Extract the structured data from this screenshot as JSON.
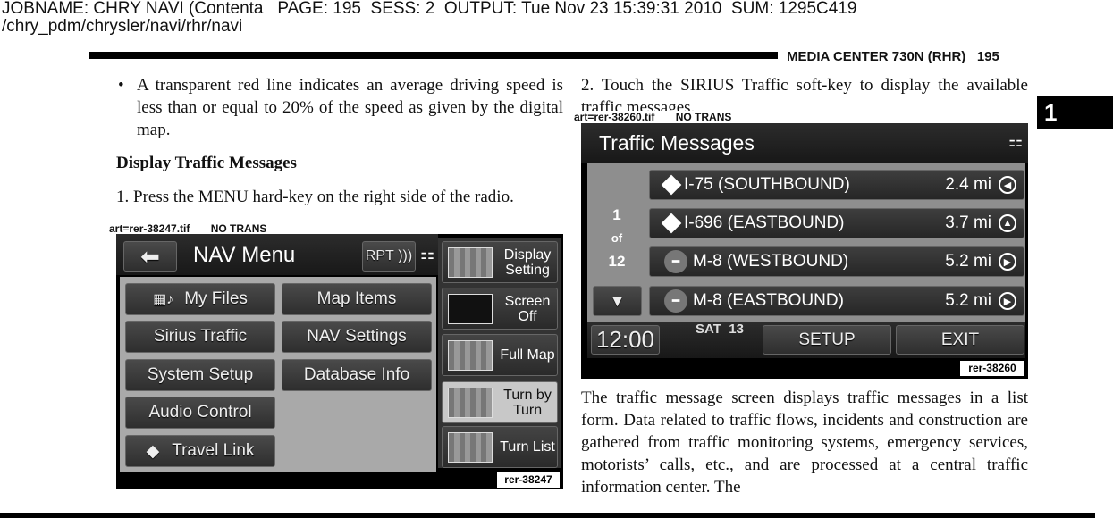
{
  "job_header": {
    "line1": "JOBNAME: CHRY NAVI (Contenta   PAGE: 195  SESS: 2  OUTPUT: Tue Nov 23 15:39:31 2010  SUM: 1295C419",
    "line2": "/chry_pdm/chrysler/navi/rhr/navi"
  },
  "running_head": {
    "title": "MEDIA CENTER 730N (RHR)",
    "page": "195"
  },
  "chapter_tab": "1",
  "left": {
    "bullet": "A transparent red line indicates an average driving speed is less than or equal to 20% of the speed as given by the digital map.",
    "heading": "Display Traffic Messages",
    "step1": "1. Press the MENU hard-key on the right side of the radio.",
    "caption": "art=rer-38247.tif       NO TRANS"
  },
  "nav_menu": {
    "title": "NAV Menu",
    "rpt": "RPT",
    "buttons": [
      "My Files",
      "Map Items",
      "Sirius Traffic",
      "NAV Settings",
      "System Setup",
      "Database Info",
      "Audio Control",
      "Travel Link"
    ],
    "side": [
      "Display Setting",
      "Screen Off",
      "Full Map",
      "Turn by Turn",
      "Turn List"
    ],
    "selected_side": "Turn by Turn",
    "label": "rer-38247"
  },
  "right": {
    "step2": "2. Touch the SIRIUS Traffic soft-key to display the available traffic messages.",
    "caption": "art=rer-38260.tif       NO TRANS",
    "para": "The traffic message screen displays traffic messages in a list form. Data related to traffic flows, incidents and construction are gathered from traffic monitoring systems, emergency services, motorists’ calls, etc., and are processed at a central traffic information center. The"
  },
  "traffic": {
    "title": "Traffic Messages",
    "page_current": "1",
    "page_of": "of",
    "page_total": "12",
    "messages": [
      {
        "road": "I-75 (SOUTHBOUND)",
        "dist": "2.4 mi",
        "icon": "construction-icon"
      },
      {
        "road": "I-696 (EASTBOUND)",
        "dist": "3.7 mi",
        "icon": "info-icon"
      },
      {
        "road": "M-8 (WESTBOUND)",
        "dist": "5.2 mi",
        "icon": "no-entry-icon"
      },
      {
        "road": "M-8 (EASTBOUND)",
        "dist": "5.2 mi",
        "icon": "no-entry-icon"
      }
    ],
    "clock": "12:00",
    "day": "SAT",
    "date": "13",
    "setup": "SETUP",
    "exit": "EXIT",
    "label": "rer-38260"
  }
}
